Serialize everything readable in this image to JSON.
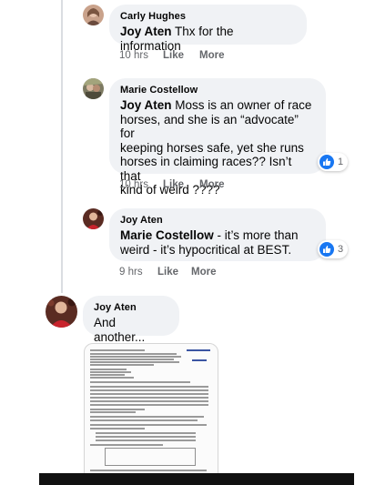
{
  "comments": [
    {
      "author": "Carly Hughes",
      "mention": "Joy Aten",
      "text": " Thx for the information",
      "time": "10 hrs",
      "like": "Like",
      "more": "More"
    },
    {
      "author": "Marie Costellow",
      "mention": "Joy Aten",
      "line1": " Moss is an owner of race",
      "line2": "horses, and she is an “advocate” for",
      "line3": "keeping horses safe, yet she runs",
      "line4": "horses in claiming races?? Isn’t that",
      "line5": "kind of weird ????",
      "time": "10 hrs",
      "like": "Like",
      "more": "More",
      "reaction_count": "1"
    },
    {
      "author": "Joy Aten",
      "mention": "Marie Costellow",
      "line1": " - it’s more than",
      "line2": "weird - it’s hypocritical at BEST.",
      "time": "9 hrs",
      "like": "Like",
      "more": "More",
      "reaction_count": "3"
    },
    {
      "author": "Joy Aten",
      "text": "And another..."
    }
  ],
  "colors": {
    "bubble": "#f0f2f5",
    "like_blue": "#1877f2",
    "meta_gray": "#65676b"
  },
  "icons": {
    "reaction": "thumbs-up-icon"
  }
}
